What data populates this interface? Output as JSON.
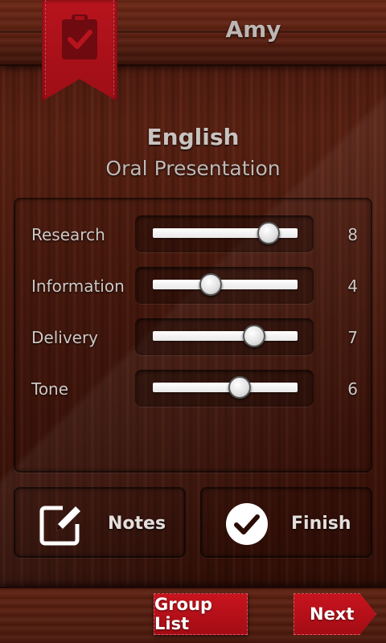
{
  "header": {
    "student_name": "Amy",
    "bookmark_icon": "clipboard-check-icon"
  },
  "assignment": {
    "subject": "English",
    "title": "Oral Presentation"
  },
  "criteria": [
    {
      "label": "Research",
      "value": "8",
      "level": 8,
      "max": 10
    },
    {
      "label": "Information",
      "value": "4",
      "level": 4,
      "max": 10
    },
    {
      "label": "Delivery",
      "value": "7",
      "level": 7,
      "max": 10
    },
    {
      "label": "Tone",
      "value": "6",
      "level": 6,
      "max": 10
    }
  ],
  "actions": {
    "notes_label": "Notes",
    "notes_icon": "edit-note-icon",
    "finish_label": "Finish",
    "finish_icon": "checkmark-circle-icon"
  },
  "footer": {
    "group_list_label": "Group List",
    "next_label": "Next"
  },
  "colors": {
    "accent": "#b8141d",
    "wood_dark": "#3a1209",
    "wood_mid": "#5b2213",
    "text": "#cfc8c4"
  }
}
